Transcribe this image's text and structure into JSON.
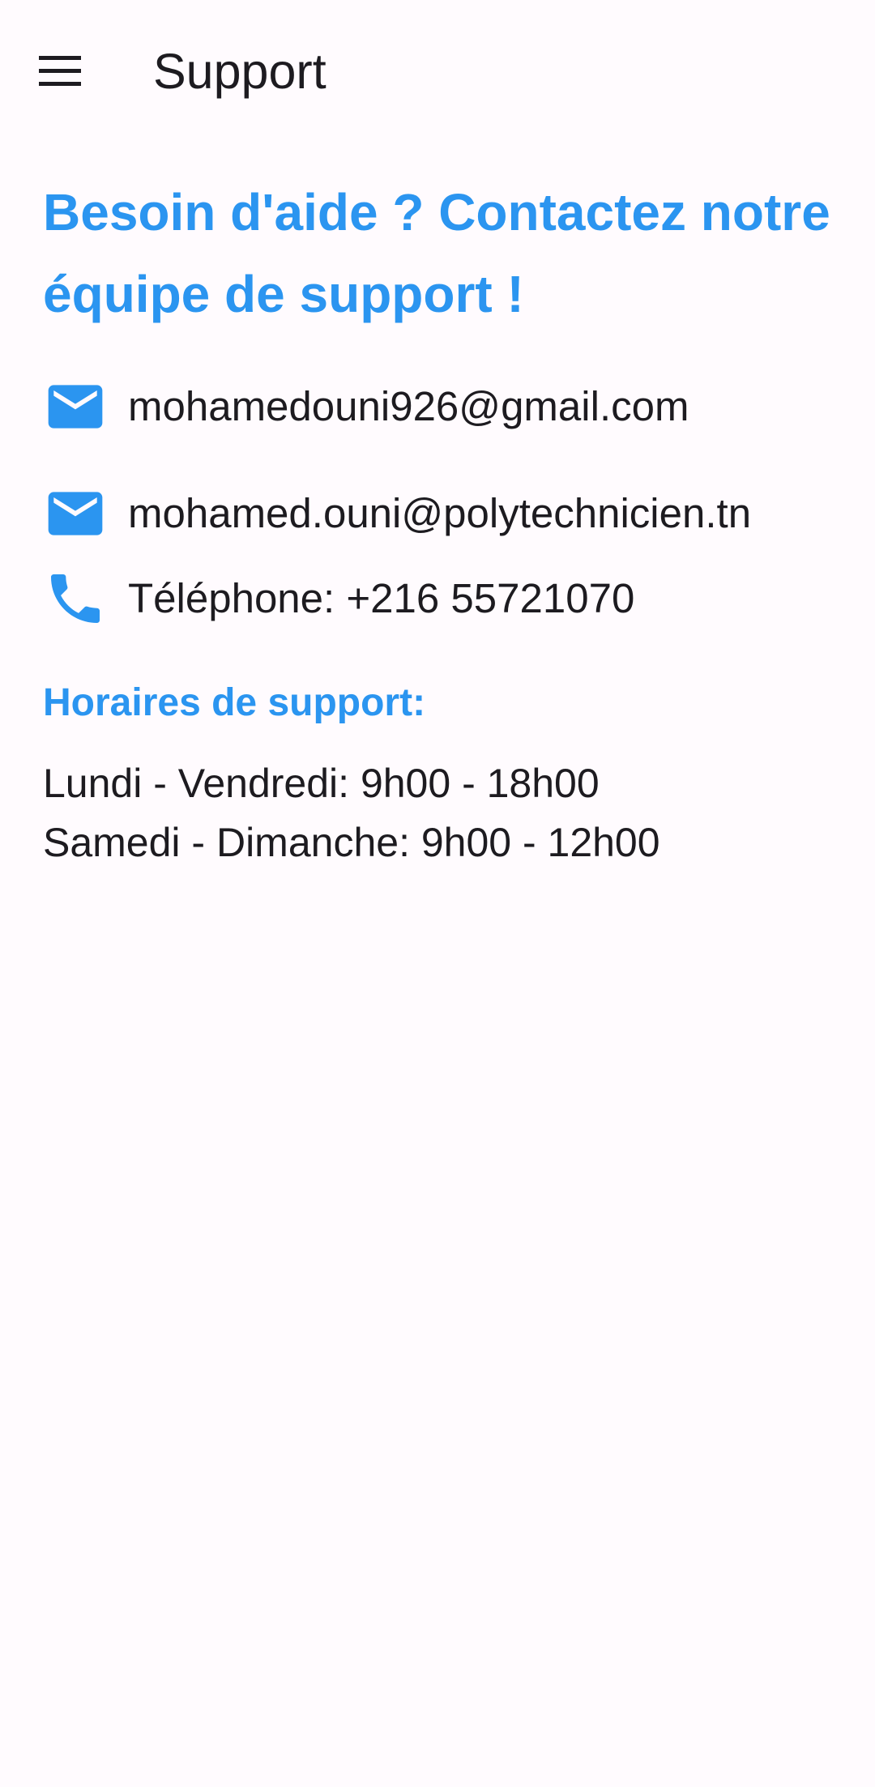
{
  "app_bar": {
    "menu_icon": "menu-icon",
    "title": "Support"
  },
  "headline": "Besoin d'aide ? Contactez notre équipe de support !",
  "contacts": [
    {
      "icon": "email-icon",
      "text": "mohamedouni926@gmail.com"
    },
    {
      "icon": "email-icon",
      "text": "mohamed.ouni@polytechnicien.tn"
    },
    {
      "icon": "phone-icon",
      "text": "Téléphone: +216 55721070"
    }
  ],
  "hours": {
    "title": "Horaires de support:",
    "lines": [
      "Lundi - Vendredi: 9h00 - 18h00",
      "Samedi - Dimanche: 9h00 - 12h00"
    ]
  },
  "colors": {
    "accent": "#2b95f0",
    "background": "#fffbfe",
    "text": "#1d1b20"
  }
}
